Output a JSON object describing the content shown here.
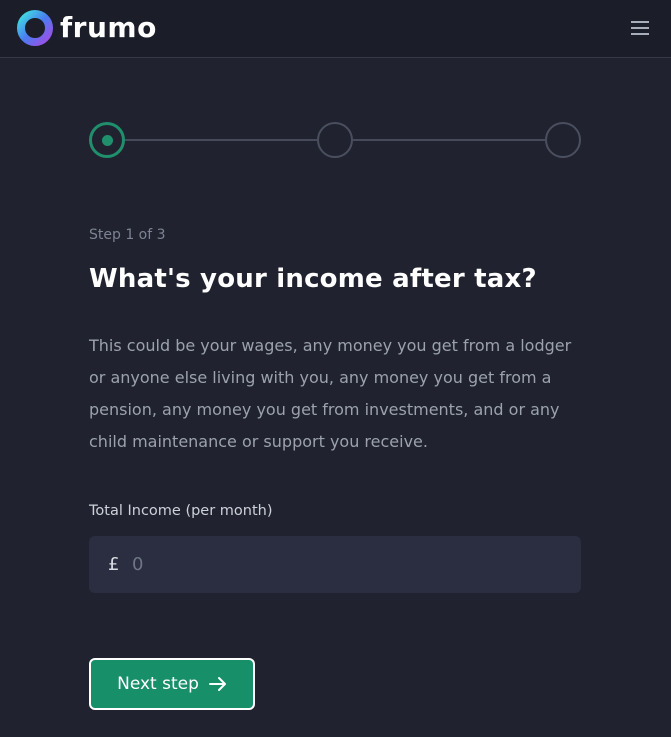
{
  "header": {
    "brand": "frumo",
    "menu_icon": "hamburger-menu-icon"
  },
  "stepper": {
    "total_steps": 3,
    "current_step": 1,
    "active_color": "#1f8f6c"
  },
  "form": {
    "step_label": "Step 1 of 3",
    "title": "What's your income after tax?",
    "description": "This could be your wages, any money you get from a lodger or anyone else living with you, any money you get from a pension, any money you get from investments, and or any child maintenance or support you receive.",
    "income_label": "Total Income (per month)",
    "currency_symbol": "£",
    "income_placeholder": "0",
    "income_value": "",
    "next_button": "Next step",
    "next_icon": "arrow-right-icon"
  },
  "colors": {
    "background": "#20232f",
    "header": "#1b1e29",
    "input_bg": "#2a2e40",
    "accent": "#178f69"
  }
}
